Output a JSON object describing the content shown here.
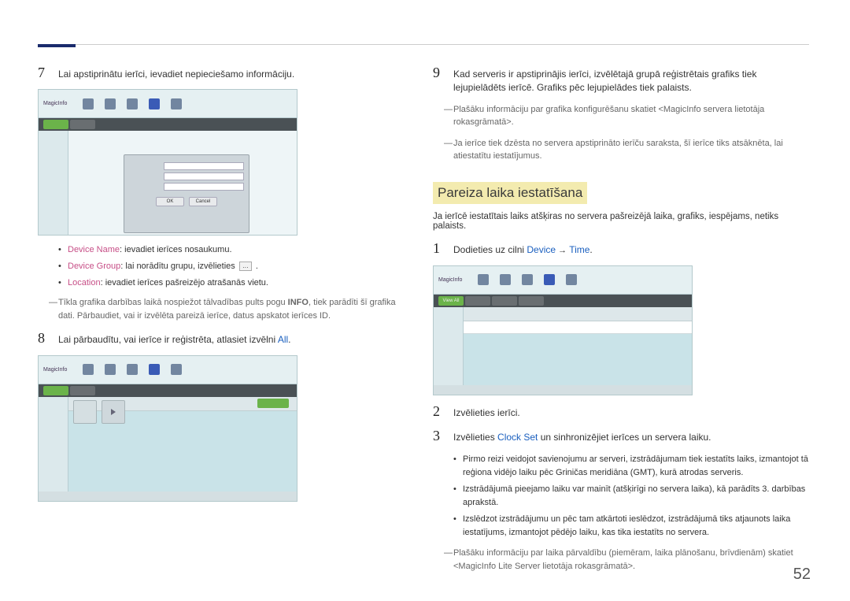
{
  "brand": "MagicInfo",
  "tabs": [
    "View All"
  ],
  "left": {
    "step7": {
      "num": "7",
      "text": "Lai apstiprinātu ierīci, ievadiet nepieciešamo informāciju."
    },
    "bullets": {
      "b1a": "Device Name",
      "b1b": ": ievadiet ierīces nosaukumu.",
      "b2a": "Device Group",
      "b2b": ": lai norādītu grupu, izvēlieties ",
      "b3a": "Location",
      "b3b": ": ievadiet ierīces pašreizējo atrašanās vietu."
    },
    "note1a": "Tīkla grafika darbības laikā nospiežot tālvadības pults pogu ",
    "note1info": "INFO",
    "note1b": ", tiek parādīti šī grafika dati. Pārbaudiet, vai ir izvēlēta pareizā ierīce, datus apskatot ierīces ID.",
    "step8": {
      "num": "8",
      "text_a": "Lai pārbaudītu, vai ierīce ir reģistrēta, atlasiet izvēlni ",
      "all": "All"
    },
    "dialog": {
      "ok": "OK",
      "cancel": "Cancel"
    }
  },
  "right": {
    "step9": {
      "num": "9",
      "text": "Kad serveris ir apstiprinājis ierīci, izvēlētajā grupā reģistrētais grafiks tiek lejupielādēts ierīcē. Grafiks pēc lejupielādes tiek palaists."
    },
    "note1": "Plašāku informāciju par grafika konfigurēšanu skatiet <MagicInfo servera lietotāja rokasgrāmatā>.",
    "note2": "Ja ierīce tiek dzēsta no servera apstiprināto ierīču saraksta, šī ierīce tiks atsāknēta, lai atiestatītu iestatījumus.",
    "section_title": "Pareiza laika iestatīšana",
    "section_sub": "Ja ierīcē iestatītais laiks atšķiras no servera pašreizējā laika, grafiks, iespējams, netiks palaists.",
    "step1": {
      "num": "1",
      "text_a": "Dodieties uz cilni ",
      "link": "Device",
      "arrow": " → ",
      "link2": "Time",
      "period": "."
    },
    "step2": {
      "num": "2",
      "text": "Izvēlieties ierīci."
    },
    "step3": {
      "num": "3",
      "text_a": "Izvēlieties ",
      "link": "Clock Set",
      "text_b": " un sinhronizējiet ierīces un servera laiku."
    },
    "bullets2": {
      "b1": "Pirmo reizi veidojot savienojumu ar serveri, izstrādājumam tiek iestatīts laiks, izmantojot tā reģiona vidējo laiku pēc Griničas meridiāna (GMT), kurā atrodas serveris.",
      "b2": "Izstrādājumā pieejamo laiku var mainīt (atšķirīgi no servera laika), kā parādīts 3. darbības aprakstā.",
      "b3": "Izslēdzot izstrādājumu un pēc tam atkārtoti ieslēdzot, izstrādājumā tiks atjaunots laika iestatījums, izmantojot pēdējo laiku, kas tika iestatīts no servera."
    },
    "note3": "Plašāku informāciju par laika pārvaldību (piemēram, laika plānošanu, brīvdienām) skatiet <MagicInfo Lite Server lietotāja rokasgrāmatā>."
  },
  "page_num": "52"
}
